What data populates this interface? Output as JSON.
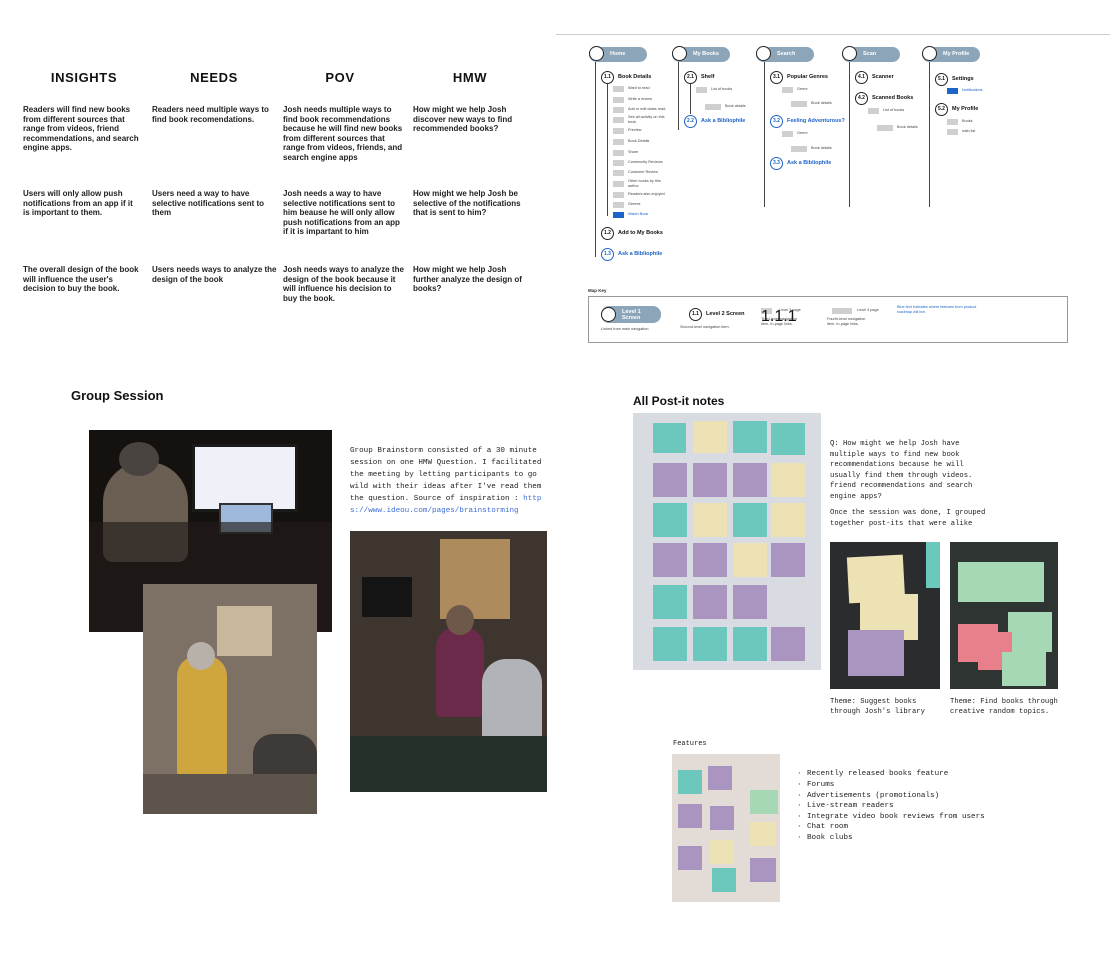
{
  "insights": {
    "headers": [
      "INSIGHTS",
      "NEEDS",
      "POV",
      "HMW"
    ],
    "rows": [
      [
        "Readers will find new books from different sources that range from videos, friend recommendations, and search engine apps.",
        "Readers need multiple ways to find book recomendations.",
        "Josh needs multiple ways to find book recommendations because he will find new books from different sources that range from videos, friends, and search engine apps",
        "How might we help Josh discover new ways to find recommended books?"
      ],
      [
        "Users will only allow push notifications from an app if it is important to them.",
        "Users need a way to have selective notifications sent to them",
        "Josh needs a way to have selective notifications sent to him beause he will only allow push notifications from an app if it is impartant to him",
        "How might we help Josh be selective of the notifications that is sent to him?"
      ],
      [
        "The overall design of the book will influence the user's decision to buy the book.",
        "Users needs ways to analyze the design of the book",
        "Josh needs ways to analyze the design of the book because it will influence his decision to buy the book.",
        "How might we help Josh further analyze the design of books?"
      ]
    ]
  },
  "sitemap": {
    "tabs": [
      {
        "num": "1",
        "label": "Home"
      },
      {
        "num": "2",
        "label": "My Books"
      },
      {
        "num": "3",
        "label": "Search"
      },
      {
        "num": "4",
        "label": "Scan"
      },
      {
        "num": "5",
        "label": "My Profile"
      }
    ],
    "home": {
      "l2": [
        {
          "num": "1.1",
          "label": "Book Details"
        },
        {
          "num": "1.2",
          "label": "Add to My Books"
        },
        {
          "num": "1.3",
          "label": "Ask a Bibliophile"
        }
      ],
      "l3": [
        {
          "num": "1.1.1",
          "label": "Want to read"
        },
        {
          "num": "1.1.2",
          "label": "Write a review"
        },
        {
          "num": "1.1.3",
          "label": "Add or edit dates read"
        },
        {
          "num": "1.1.4",
          "label": "See all activity on this book"
        },
        {
          "num": "1.1.5",
          "label": "Preview"
        },
        {
          "num": "1.1.6",
          "label": "Book Details"
        },
        {
          "num": "1.1.7",
          "label": "Share"
        },
        {
          "num": "1.1.8",
          "label": "Community Reviews"
        },
        {
          "num": "1.1.9",
          "label": "Customer Review"
        },
        {
          "num": "1.1.10",
          "label": "Other books by this author"
        },
        {
          "num": "1.1.11",
          "label": "Readers also enjoyed"
        },
        {
          "num": "1.1.12",
          "label": "Genres"
        },
        {
          "num": "1.1.13",
          "label": "Watch Book"
        }
      ]
    },
    "mybooks": {
      "l2": [
        {
          "num": "2.1",
          "label": "Shelf"
        },
        {
          "num": "2.2",
          "label": "Ask a Bibliophile"
        }
      ],
      "l3": [
        {
          "num": "2.1.1",
          "label": "List of books"
        }
      ],
      "l4": [
        {
          "num": "2.1.1.1",
          "label": "Book details"
        }
      ]
    },
    "search": {
      "l2": [
        {
          "num": "3.1",
          "label": "Popular Genres"
        },
        {
          "num": "3.2",
          "label": "Feeling Adventurous?"
        },
        {
          "num": "3.3",
          "label": "Ask a Bibliophile"
        }
      ],
      "l3": [
        {
          "num": "3.1.1",
          "label": "Genre"
        },
        {
          "num": "3.2.1",
          "label": "Genre"
        }
      ],
      "l4": [
        {
          "num": "3.1.1.1",
          "label": "Book details"
        },
        {
          "num": "3.2.1.1",
          "label": "Book details"
        }
      ]
    },
    "scan": {
      "l2": [
        {
          "num": "4.1",
          "label": "Scanner"
        },
        {
          "num": "4.2",
          "label": "Scanned Books"
        }
      ],
      "l3": [
        {
          "num": "4.2.1",
          "label": "List of books"
        }
      ],
      "l4": [
        {
          "num": "4.2.1.1",
          "label": "Book details"
        }
      ]
    },
    "profile": {
      "l2": [
        {
          "num": "5.1",
          "label": "Settings"
        },
        {
          "num": "5.2",
          "label": "My Profile"
        }
      ],
      "l3": [
        {
          "num": "5.1.1",
          "label": "Notifications"
        },
        {
          "num": "5.2.1",
          "label": "Books"
        },
        {
          "num": "5.2.2",
          "label": "wish list"
        }
      ]
    }
  },
  "mapkey": {
    "title": "Map Key",
    "l1_num": "1",
    "l1_label": "Level 1 Screen",
    "l1_desc": "Linked from main navigation",
    "l2_num": "1.1",
    "l2_label": "Level 2 Screen",
    "l2_desc": "Second-level navigation item.",
    "l3_num": "1.1.1",
    "l3_label": "Level 3 page",
    "l3_desc": "Third-level navigation item. In-page links.",
    "l4_num": "1.1.1.1",
    "l4_label": "Level 4 page",
    "l4_desc": "Fourth-level navigation item. In-page links.",
    "blue_note": "Blue text indicates where features from product roadmap will live."
  },
  "group": {
    "title": "Group Session",
    "desc": "Group Brainstorm consisted of a 30 minute session on one HMW Question. I facilitated the meeting by letting participants to go wild with their ideas after I've read them the question. Source of inspiration :",
    "link": "https://www.ideou.com/pages/brainstorming"
  },
  "postits": {
    "title": "All Post-it notes",
    "question": "Q: How might we help Josh have multiple ways to find new book recommendations because he will usually find them through videos. friend recommendations and search engine apps?",
    "grouped": "Once the session was done, I grouped together post-its that were alike",
    "theme1": "Theme: Suggest books through Josh's library",
    "theme2": "Theme: Find books through creative random topics.",
    "features_label": "Features",
    "features": [
      "Recently released books feature",
      "Forums",
      "Advertisements (promotionals)",
      "Live-stream readers",
      "Integrate video book reviews from users",
      "Chat room",
      "Book clubs"
    ]
  },
  "colors": {
    "tab": "#8da5b8",
    "blue": "#1e63c7",
    "link": "#3d6fd6"
  }
}
